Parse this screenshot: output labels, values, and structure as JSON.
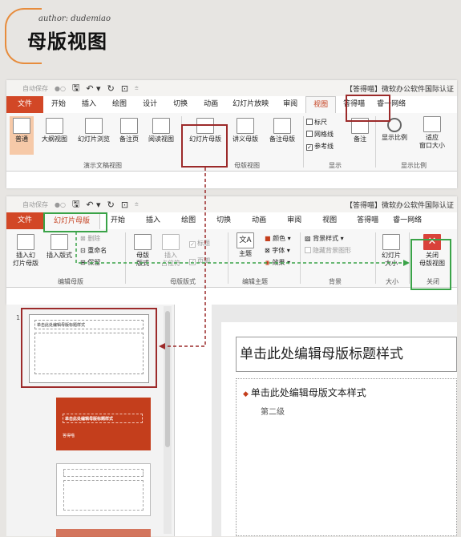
{
  "header": {
    "author": "author: dudemiao",
    "title": "母版视图"
  },
  "window1": {
    "autosave": "自动保存",
    "title": "【答得喵】微软办公软件国际认证",
    "tabs": [
      "文件",
      "开始",
      "插入",
      "绘图",
      "设计",
      "切换",
      "动画",
      "幻灯片放映",
      "审阅",
      "视图",
      "答得喵",
      "睿一网络"
    ],
    "active_tab": "视图",
    "buttons": {
      "normal": "普通",
      "outline": "大纲视图",
      "sorter": "幻灯片浏览",
      "notes_page": "备注页",
      "reading": "阅读视图",
      "slide_master": "幻灯片母版",
      "handout_master": "讲义母版",
      "notes_master": "备注母版",
      "ruler": "标尺",
      "gridlines": "网格线",
      "guides": "参考线",
      "notes": "备注",
      "zoom": "显示比例",
      "fit": "适应",
      "fit2": "窗口大小"
    },
    "groups": {
      "presentation_views": "演示文稿视图",
      "master_views": "母版视图",
      "show": "显示",
      "zoom": "显示比例"
    }
  },
  "window2": {
    "autosave": "自动保存",
    "title": "【答得喵】微软办公软件国际认证",
    "tabs": [
      "文件",
      "幻灯片母版",
      "开始",
      "插入",
      "绘图",
      "切换",
      "动画",
      "审阅",
      "视图",
      "答得喵",
      "睿一网络"
    ],
    "active_tab": "幻灯片母版",
    "buttons": {
      "insert_master": "插入幻",
      "insert_master2": "灯片母版",
      "insert_layout": "插入版式",
      "delete": "删除",
      "rename": "重命名",
      "preserve": "保留",
      "master_layout": "母版",
      "master_layout2": "版式",
      "insert_placeholder": "插入",
      "insert_placeholder2": "占位符",
      "title_chk": "标题",
      "footer_chk": "页脚",
      "theme": "主题",
      "colors": "颜色",
      "fonts": "字体",
      "effects": "效果",
      "bg_styles": "背景样式",
      "hide_bg": "隐藏背景图形",
      "slide_size": "幻灯片",
      "slide_size2": "大小",
      "close_master": "关闭",
      "close_master2": "母版视图"
    },
    "groups": {
      "edit_master": "编辑母版",
      "master_layout": "母版版式",
      "edit_theme": "编辑主题",
      "background": "背景",
      "size": "大小",
      "close": "关闭"
    }
  },
  "slides": {
    "number": "1",
    "thumb1_title": "单击此处编辑母版标题样式",
    "thumb2_title": "单击此处编辑母版标题样式",
    "thumb2_brand": "答得喵"
  },
  "editor": {
    "title": "单击此处编辑母版标题样式",
    "bullet": "单击此处编辑母版文本样式",
    "level2": "第二级"
  },
  "colors": {
    "accent_red": "#9c2a2a",
    "accent_green": "#3aa348",
    "file_tab": "#d24726",
    "close_icon": "#d9423a"
  }
}
